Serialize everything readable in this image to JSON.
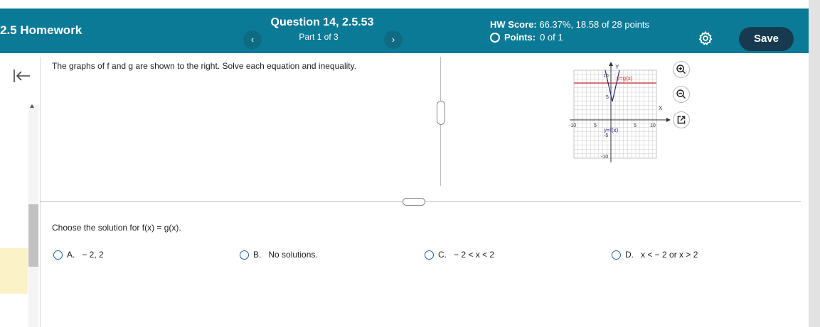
{
  "header": {
    "title": "2.5 Homework",
    "question_title": "Question 14, 2.5.53",
    "part": "Part 1 of 3",
    "hw_score_label": "HW Score:",
    "hw_score_value": "66.37%, 18.58 of 28 points",
    "points_label": "Points:",
    "points_value": "0 of 1",
    "save_label": "Save",
    "prev_icon": "chevron-left-icon",
    "next_icon": "chevron-right-icon",
    "settings_icon": "gear-icon",
    "bar_color": "#0b7a96",
    "save_color": "#173a50"
  },
  "question": {
    "prompt": "The graphs of f and g are shown to the right. Solve each equation and inequality.",
    "choose": "Choose the solution for f(x) = g(x)."
  },
  "graph": {
    "y_axis_label": "Y",
    "x_axis_label": "X",
    "f_label": "y=f(x)",
    "g_label": "y=g(x)",
    "tick_10": "10",
    "tick_5": "5",
    "tick_neg_10": "-10",
    "tick_neg_5": "-5",
    "x_tick_10": "10",
    "x_tick_5": "5",
    "x_tick_neg_10": "-10",
    "x_tick_neg_5": "5",
    "f_color": "#2a2a8a",
    "g_color": "#d03030"
  },
  "options": [
    {
      "letter": "A.",
      "text": "− 2, 2"
    },
    {
      "letter": "B.",
      "text": "No solutions."
    },
    {
      "letter": "C.",
      "text": "− 2 < x < 2"
    },
    {
      "letter": "D.",
      "text": "x < − 2 or x > 2"
    }
  ],
  "tools": [
    "zoom-in-icon",
    "zoom-out-icon",
    "popout-icon"
  ]
}
